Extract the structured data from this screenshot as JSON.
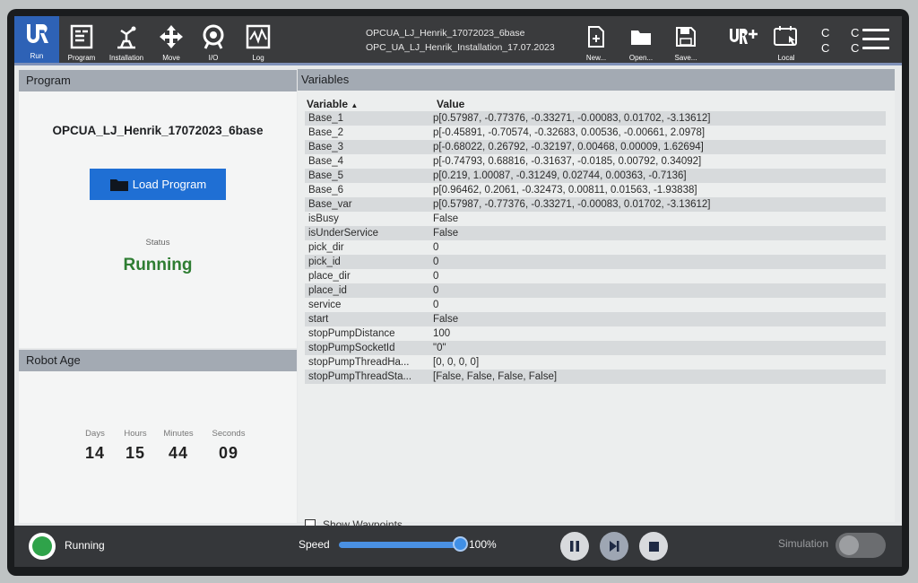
{
  "topbar": {
    "nav": [
      {
        "label": "Run",
        "icon": "ur-logo-icon"
      },
      {
        "label": "Program",
        "icon": "program-icon"
      },
      {
        "label": "Installation",
        "icon": "installation-icon"
      },
      {
        "label": "Move",
        "icon": "move-icon"
      },
      {
        "label": "I/O",
        "icon": "io-icon"
      },
      {
        "label": "Log",
        "icon": "log-icon"
      }
    ],
    "program_file": "OPCUA_LJ_Henrik_17072023_6base",
    "installation_file": "OPC_UA_LJ_Henrik_Installation_17.07.2023",
    "file_actions": [
      {
        "label": "New...",
        "icon": "new-file-icon"
      },
      {
        "label": "Open...",
        "icon": "folder-icon"
      },
      {
        "label": "Save...",
        "icon": "save-icon"
      }
    ],
    "urplus_icon": "urplus-icon",
    "local_label": "Local",
    "cc_top": "C C",
    "cc_bottom": "C C"
  },
  "program_panel": {
    "title": "Program",
    "program_name": "OPCUA_LJ_Henrik_17072023_6base",
    "load_button": "Load Program",
    "status_label": "Status",
    "status_value": "Running"
  },
  "robot_age": {
    "title": "Robot Age",
    "days_label": "Days",
    "days": "14",
    "hours_label": "Hours",
    "hours": "15",
    "minutes_label": "Minutes",
    "minutes": "44",
    "seconds_label": "Seconds",
    "seconds": "09"
  },
  "variables": {
    "title": "Variables",
    "col_variable": "Variable",
    "col_value": "Value",
    "rows": [
      {
        "name": "Base_1",
        "value": "p[0.57987, -0.77376, -0.33271, -0.00083, 0.01702, -3.13612]"
      },
      {
        "name": "Base_2",
        "value": "p[-0.45891, -0.70574, -0.32683, 0.00536, -0.00661, 2.0978]"
      },
      {
        "name": "Base_3",
        "value": "p[-0.68022, 0.26792, -0.32197, 0.00468, 0.00009, 1.62694]"
      },
      {
        "name": "Base_4",
        "value": "p[-0.74793, 0.68816, -0.31637, -0.0185, 0.00792, 0.34092]"
      },
      {
        "name": "Base_5",
        "value": "p[0.219, 1.00087, -0.31249, 0.02744, 0.00363, -0.7136]"
      },
      {
        "name": "Base_6",
        "value": "p[0.96462, 0.2061, -0.32473, 0.00811, 0.01563, -1.93838]"
      },
      {
        "name": "Base_var",
        "value": "p[0.57987, -0.77376, -0.33271, -0.00083, 0.01702, -3.13612]"
      },
      {
        "name": "isBusy",
        "value": "False"
      },
      {
        "name": "isUnderService",
        "value": "False"
      },
      {
        "name": "pick_dir",
        "value": "0"
      },
      {
        "name": "pick_id",
        "value": "0"
      },
      {
        "name": "place_dir",
        "value": "0"
      },
      {
        "name": "place_id",
        "value": "0"
      },
      {
        "name": "service",
        "value": "0"
      },
      {
        "name": "start",
        "value": "False"
      },
      {
        "name": "stopPumpDistance",
        "value": "100"
      },
      {
        "name": "stopPumpSocketId",
        "value": "\"0\""
      },
      {
        "name": "stopPumpThreadHa...",
        "value": "[0, 0, 0, 0]"
      },
      {
        "name": "stopPumpThreadSta...",
        "value": "[False, False, False, False]"
      }
    ],
    "show_waypoints": "Show Waypoints"
  },
  "bottombar": {
    "status": "Running",
    "speed_label": "Speed",
    "speed_value": "100%",
    "speed_fraction": 1.0,
    "simulation_label": "Simulation",
    "colors": {
      "running": "#2fa34a",
      "accent": "#2e62b6"
    }
  }
}
